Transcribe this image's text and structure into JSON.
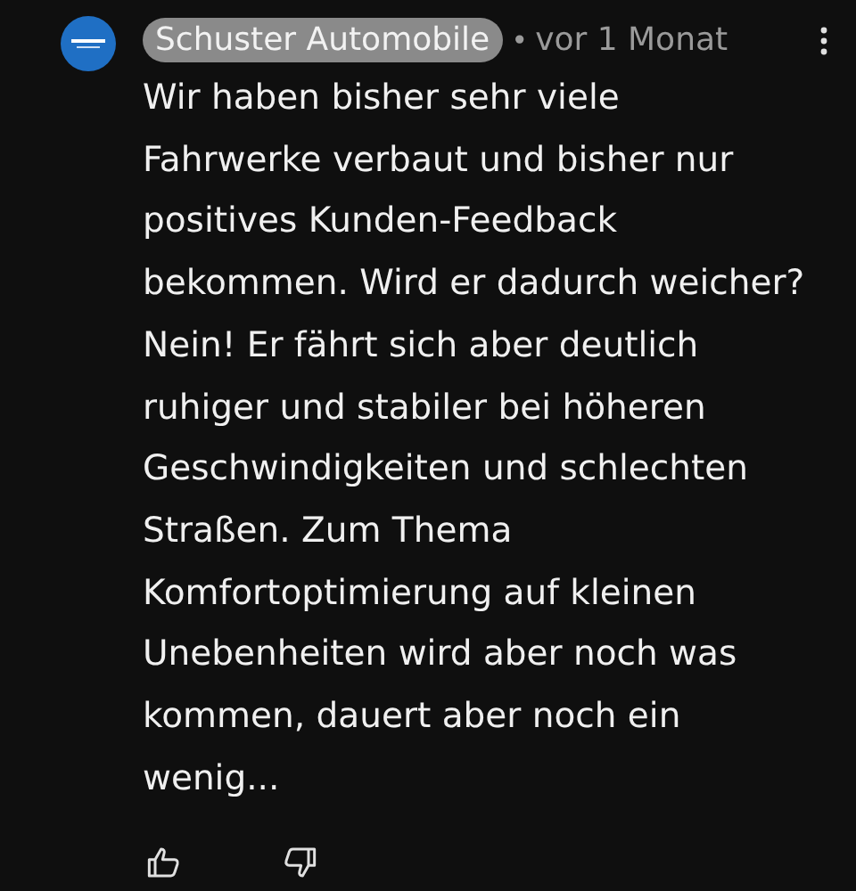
{
  "comment": {
    "author": "Schuster Automobile",
    "author_highlighted": true,
    "separator": "•",
    "time": "vor 1 Monat",
    "text": "Wir haben bisher sehr viele Fahrwerke verbaut und bisher nur positives Kunden-Feedback bekommen. Wird er dadurch weicher? Nein! Er fährt sich aber deutlich ruhiger und stabiler bei höheren Geschwindigkeiten und schlechten Straßen. Zum Thema Komfortoptimierung auf kleinen Unebenheiten wird aber noch was kommen, dauert aber noch ein wenig..."
  }
}
